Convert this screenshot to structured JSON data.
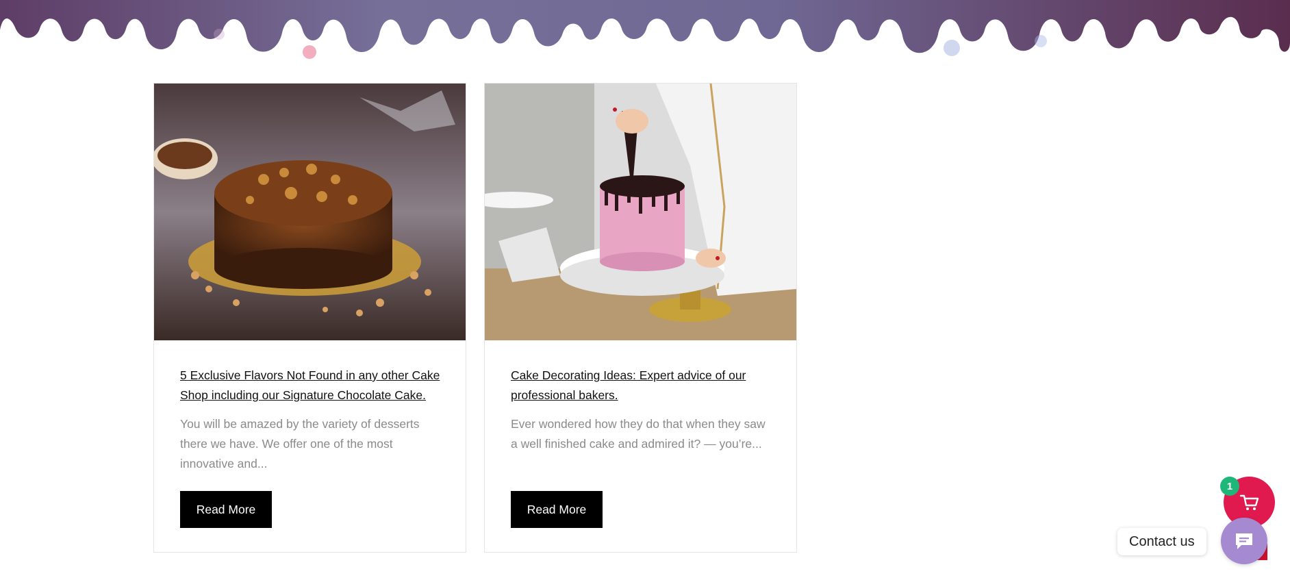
{
  "posts": [
    {
      "title": "5 Exclusive Flavors Not Found in any other Cake Shop including our Signature Chocolate Cake.",
      "excerpt": "You will be amazed by the variety of desserts there we have. We offer one of the most innovative and...",
      "button_label": "Read More",
      "image_icon": "chocolate-cake-image"
    },
    {
      "title": "Cake Decorating Ideas: Expert advice of our professional bakers.",
      "excerpt": "Ever wondered how they do that when they saw a well finished cake and admired it? — you’re...",
      "button_label": "Read More",
      "image_icon": "pink-cake-decorating-image"
    }
  ],
  "cart": {
    "count": "1",
    "icon": "cart-icon"
  },
  "contact": {
    "label": "Contact us",
    "icon": "chat-icon"
  },
  "colors": {
    "drip": "#6a5486",
    "button_bg": "#000000",
    "cart_bg": "#e01a4f",
    "badge_bg": "#1fb67a",
    "chat_bg": "#a58ad1"
  }
}
